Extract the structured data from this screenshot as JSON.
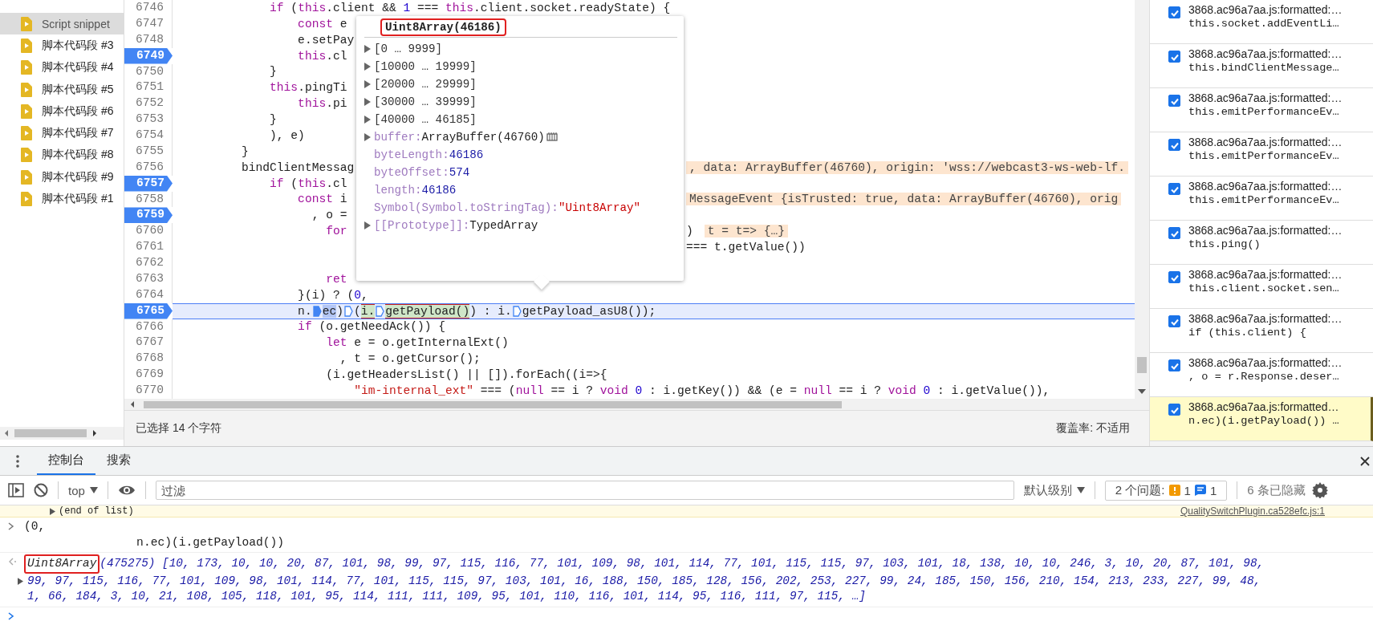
{
  "sidebar": {
    "items": [
      {
        "label": "Script snippet",
        "selected": true
      },
      {
        "label": "脚本代码段 #3",
        "selected": false
      },
      {
        "label": "脚本代码段 #4",
        "selected": false
      },
      {
        "label": "脚本代码段 #5",
        "selected": false
      },
      {
        "label": "脚本代码段 #6",
        "selected": false
      },
      {
        "label": "脚本代码段 #7",
        "selected": false
      },
      {
        "label": "脚本代码段 #8",
        "selected": false
      },
      {
        "label": "脚本代码段 #9",
        "selected": false
      },
      {
        "label": "脚本代码段 #1",
        "selected": false
      }
    ]
  },
  "editor": {
    "lines": [
      {
        "number": "6746",
        "breakpoint": false,
        "current": false,
        "tokens": [
          {
            "text": "            if",
            "kind": "keyword"
          },
          {
            "text": " (",
            "kind": "plain"
          },
          {
            "text": "this",
            "kind": "keyword"
          },
          {
            "text": ".client && ",
            "kind": "plain"
          },
          {
            "text": "1",
            "kind": "number"
          },
          {
            "text": " === ",
            "kind": "plain"
          },
          {
            "text": "this",
            "kind": "keyword"
          },
          {
            "text": ".client.socket.readyState) {",
            "kind": "plain"
          }
        ]
      },
      {
        "number": "6747",
        "breakpoint": false,
        "current": false,
        "tokens": [
          {
            "text": "                const",
            "kind": "keyword"
          },
          {
            "text": " e",
            "kind": "plain"
          }
        ]
      },
      {
        "number": "6748",
        "breakpoint": false,
        "current": false,
        "tokens": [
          {
            "text": "                e.setPay",
            "kind": "plain"
          }
        ]
      },
      {
        "number": "6749",
        "breakpoint": true,
        "current": false,
        "tokens": [
          {
            "text": "                this",
            "kind": "keyword"
          },
          {
            "text": ".cl",
            "kind": "plain"
          }
        ]
      },
      {
        "number": "6750",
        "breakpoint": false,
        "current": false,
        "tokens": [
          {
            "text": "            }",
            "kind": "plain"
          }
        ]
      },
      {
        "number": "6751",
        "breakpoint": false,
        "current": false,
        "tokens": [
          {
            "text": "            this",
            "kind": "keyword"
          },
          {
            "text": ".pingTi",
            "kind": "plain"
          }
        ]
      },
      {
        "number": "6752",
        "breakpoint": false,
        "current": false,
        "tokens": [
          {
            "text": "                this",
            "kind": "keyword"
          },
          {
            "text": ".pi",
            "kind": "plain"
          }
        ]
      },
      {
        "number": "6753",
        "breakpoint": false,
        "current": false,
        "tokens": [
          {
            "text": "            }",
            "kind": "plain"
          }
        ]
      },
      {
        "number": "6754",
        "breakpoint": false,
        "current": false,
        "tokens": [
          {
            "text": "            ), e)",
            "kind": "plain"
          }
        ]
      },
      {
        "number": "6755",
        "breakpoint": false,
        "current": false,
        "tokens": [
          {
            "text": "        }",
            "kind": "plain"
          }
        ]
      },
      {
        "number": "6756",
        "breakpoint": false,
        "current": false,
        "tokens": [
          {
            "text": "        bindClientMessag",
            "kind": "plain"
          }
        ],
        "inline": [
          {
            "text": ", data: ArrayBuffer(46760), origin: 'wss://webcast3-ws-web-lf.",
            "kind": "value"
          }
        ]
      },
      {
        "number": "6757",
        "breakpoint": true,
        "current": false,
        "tokens": [
          {
            "text": "            if",
            "kind": "keyword"
          },
          {
            "text": " (",
            "kind": "plain"
          },
          {
            "text": "this",
            "kind": "keyword"
          },
          {
            "text": ".cl",
            "kind": "plain"
          }
        ]
      },
      {
        "number": "6758",
        "breakpoint": false,
        "current": false,
        "tokens": [
          {
            "text": "                const",
            "kind": "keyword"
          },
          {
            "text": " i",
            "kind": "plain"
          }
        ],
        "inline": [
          {
            "text": "MessageEvent {isTrusted: true, data: ArrayBuffer(46760), orig",
            "kind": "value"
          }
        ]
      },
      {
        "number": "6759",
        "breakpoint": true,
        "current": false,
        "tokens": [
          {
            "text": "                  , o =",
            "kind": "plain"
          }
        ]
      },
      {
        "number": "6760",
        "breakpoint": false,
        "current": false,
        "tokens": [
          {
            "text": "                    for",
            "kind": "keyword"
          }
        ],
        "inline": [
          {
            "text": ")",
            "kind": "code"
          },
          {
            "text": "t = t=> {…}",
            "kind": "value"
          }
        ]
      },
      {
        "number": "6761",
        "breakpoint": false,
        "current": false,
        "inline": [
          {
            "text": "=== t.getValue())",
            "kind": "code"
          }
        ]
      },
      {
        "number": "6762",
        "breakpoint": false,
        "current": false
      },
      {
        "number": "6763",
        "breakpoint": false,
        "current": false,
        "tokens": [
          {
            "text": "                    ret",
            "kind": "keyword"
          }
        ]
      },
      {
        "number": "6764",
        "breakpoint": false,
        "current": false,
        "tokens": [
          {
            "text": "                }(i) ? (",
            "kind": "plain"
          },
          {
            "text": "0",
            "kind": "number"
          },
          {
            "text": ",",
            "kind": "plain"
          }
        ]
      },
      {
        "number": "6765",
        "breakpoint": true,
        "current": true,
        "tokens": [
          {
            "text": "                n.",
            "kind": "plain"
          },
          {
            "kind": "marker",
            "on": true
          },
          {
            "text": "ec",
            "kind": "selected"
          },
          {
            "text": ")",
            "kind": "plain"
          },
          {
            "kind": "marker",
            "on": false
          },
          {
            "text": "(",
            "kind": "plain"
          },
          {
            "text": "i.",
            "kind": "evaluated"
          },
          {
            "kind": "marker",
            "on": false
          },
          {
            "text": "getPayload()",
            "kind": "evaluated"
          },
          {
            "text": ") : i.",
            "kind": "plain"
          },
          {
            "kind": "marker",
            "on": false
          },
          {
            "text": "getPayload_asU8());",
            "kind": "plain"
          }
        ]
      },
      {
        "number": "6766",
        "breakpoint": false,
        "current": false,
        "tokens": [
          {
            "text": "                if",
            "kind": "keyword"
          },
          {
            "text": " (o.getNeedAck()) {",
            "kind": "plain"
          }
        ]
      },
      {
        "number": "6767",
        "breakpoint": false,
        "current": false,
        "tokens": [
          {
            "text": "                    let",
            "kind": "keyword"
          },
          {
            "text": " e = o.getInternalExt()",
            "kind": "plain"
          }
        ]
      },
      {
        "number": "6768",
        "breakpoint": false,
        "current": false,
        "tokens": [
          {
            "text": "                      , t = o.getCursor();",
            "kind": "plain"
          }
        ]
      },
      {
        "number": "6769",
        "breakpoint": false,
        "current": false,
        "tokens": [
          {
            "text": "                    (i.getHeadersList() || []).forEach((i=>{",
            "kind": "plain"
          }
        ]
      },
      {
        "number": "6770",
        "breakpoint": false,
        "current": false,
        "tokens": [
          {
            "text": "                        \"im-internal_ext\"",
            "kind": "string"
          },
          {
            "text": " === (",
            "kind": "plain"
          },
          {
            "text": "null",
            "kind": "keyword"
          },
          {
            "text": " == i ? ",
            "kind": "plain"
          },
          {
            "text": "void",
            "kind": "keyword"
          },
          {
            "text": " 0",
            "kind": "number"
          },
          {
            "text": " : i.getKey()) && (e = ",
            "kind": "plain"
          },
          {
            "text": "null",
            "kind": "keyword"
          },
          {
            "text": " == i ? ",
            "kind": "plain"
          },
          {
            "text": "void",
            "kind": "keyword"
          },
          {
            "text": " 0",
            "kind": "number"
          },
          {
            "text": " : i.getValue()),",
            "kind": "plain"
          }
        ]
      }
    ],
    "popover": {
      "title": "Uint8Array(46186)",
      "rows": [
        {
          "kind": "range",
          "label": "[0 … 9999]",
          "expandable": true
        },
        {
          "kind": "range",
          "label": "[10000 … 19999]",
          "expandable": true
        },
        {
          "kind": "range",
          "label": "[20000 … 29999]",
          "expandable": true
        },
        {
          "kind": "range",
          "label": "[30000 … 39999]",
          "expandable": true
        },
        {
          "kind": "range",
          "label": "[40000 … 46185]",
          "expandable": true
        },
        {
          "kind": "object",
          "key": "buffer:",
          "value": "ArrayBuffer(46760)",
          "expandable": true,
          "memory_inspector": true
        },
        {
          "kind": "number",
          "key": "byteLength:",
          "value": "46186",
          "expandable": false,
          "memory_inspector": false
        },
        {
          "kind": "number",
          "key": "byteOffset:",
          "value": "574",
          "expandable": false,
          "memory_inspector": false
        },
        {
          "kind": "number",
          "key": "length:",
          "value": "46186",
          "expandable": false,
          "memory_inspector": false
        },
        {
          "kind": "string",
          "key": "Symbol(Symbol.toStringTag):",
          "value": "\"Uint8Array\"",
          "expandable": false,
          "memory_inspector": false
        },
        {
          "kind": "object",
          "key": "[[Prototype]]:",
          "value": "TypedArray",
          "expandable": true,
          "memory_inspector": false
        }
      ]
    }
  },
  "status_bar": {
    "selection": "已选择 14 个字符",
    "coverage": "覆盖率: 不适用"
  },
  "breakpoints": [
    {
      "file": "3868.ac96a7aa.js:formatted:…",
      "code": "this.socket.addEventLi…",
      "checked": true,
      "selected": false
    },
    {
      "file": "3868.ac96a7aa.js:formatted:…",
      "code": "this.bindClientMessage…",
      "checked": true,
      "selected": false
    },
    {
      "file": "3868.ac96a7aa.js:formatted:…",
      "code": "this.emitPerformanceEv…",
      "checked": true,
      "selected": false
    },
    {
      "file": "3868.ac96a7aa.js:formatted:…",
      "code": "this.emitPerformanceEv…",
      "checked": true,
      "selected": false
    },
    {
      "file": "3868.ac96a7aa.js:formatted:…",
      "code": "this.emitPerformanceEv…",
      "checked": true,
      "selected": false
    },
    {
      "file": "3868.ac96a7aa.js:formatted:…",
      "code": "this.ping()",
      "checked": true,
      "selected": false
    },
    {
      "file": "3868.ac96a7aa.js:formatted:…",
      "code": "this.client.socket.sen…",
      "checked": true,
      "selected": false
    },
    {
      "file": "3868.ac96a7aa.js:formatted:…",
      "code": "if (this.client) {",
      "checked": true,
      "selected": false
    },
    {
      "file": "3868.ac96a7aa.js:formatted:…",
      "code": ", o = r.Response.deser…",
      "checked": true,
      "selected": false
    },
    {
      "file": "3868.ac96a7aa.js:formatted…",
      "code": "n.ec)(i.getPayload()) …",
      "checked": true,
      "selected": true
    }
  ],
  "drawer": {
    "tabs": [
      {
        "label": "控制台",
        "selected": true
      },
      {
        "label": "搜索",
        "selected": false
      }
    ],
    "toolbar": {
      "context": "top",
      "filter_placeholder": "过滤",
      "level": "默认级别",
      "issues_label": "2 个问题:",
      "warning_count": "1",
      "info_count": "1",
      "hidden": "6 条已隐藏"
    },
    "messages": [
      {
        "kind": "warning",
        "text": "(end of list)",
        "link": "QualitySwitchPlugin.ca528efc.js:1"
      },
      {
        "kind": "input",
        "lines": [
          "(0,",
          "                n.ec)(i.getPayload())"
        ]
      },
      {
        "kind": "result",
        "type_name": "Uint8Array",
        "lines": [
          "(475275) [10, 173, 10, 10, 20, 87, 101, 98, 99, 97, 115, 116, 77, 101, 109, 98, 101, 114, 77, 101, 115, 115, 97, 103, 101, 18, 138, 10, 10, 246, 3, 10, 20, 87, 101, 98,",
          "99, 97, 115, 116, 77, 101, 109, 98, 101, 114, 77, 101, 115, 115, 97, 103, 101, 16, 188, 150, 185, 128, 156, 202, 253, 227, 99, 24, 185, 150, 156, 210, 154, 213, 233, 227, 99, 48,",
          "1, 66, 184, 3, 10, 21, 108, 105, 118, 101, 95, 114, 111, 111, 109, 95, 101, 110, 116, 101, 114, 95, 116, 111, 97, 115, …]"
        ]
      },
      {
        "kind": "prompt"
      }
    ]
  }
}
